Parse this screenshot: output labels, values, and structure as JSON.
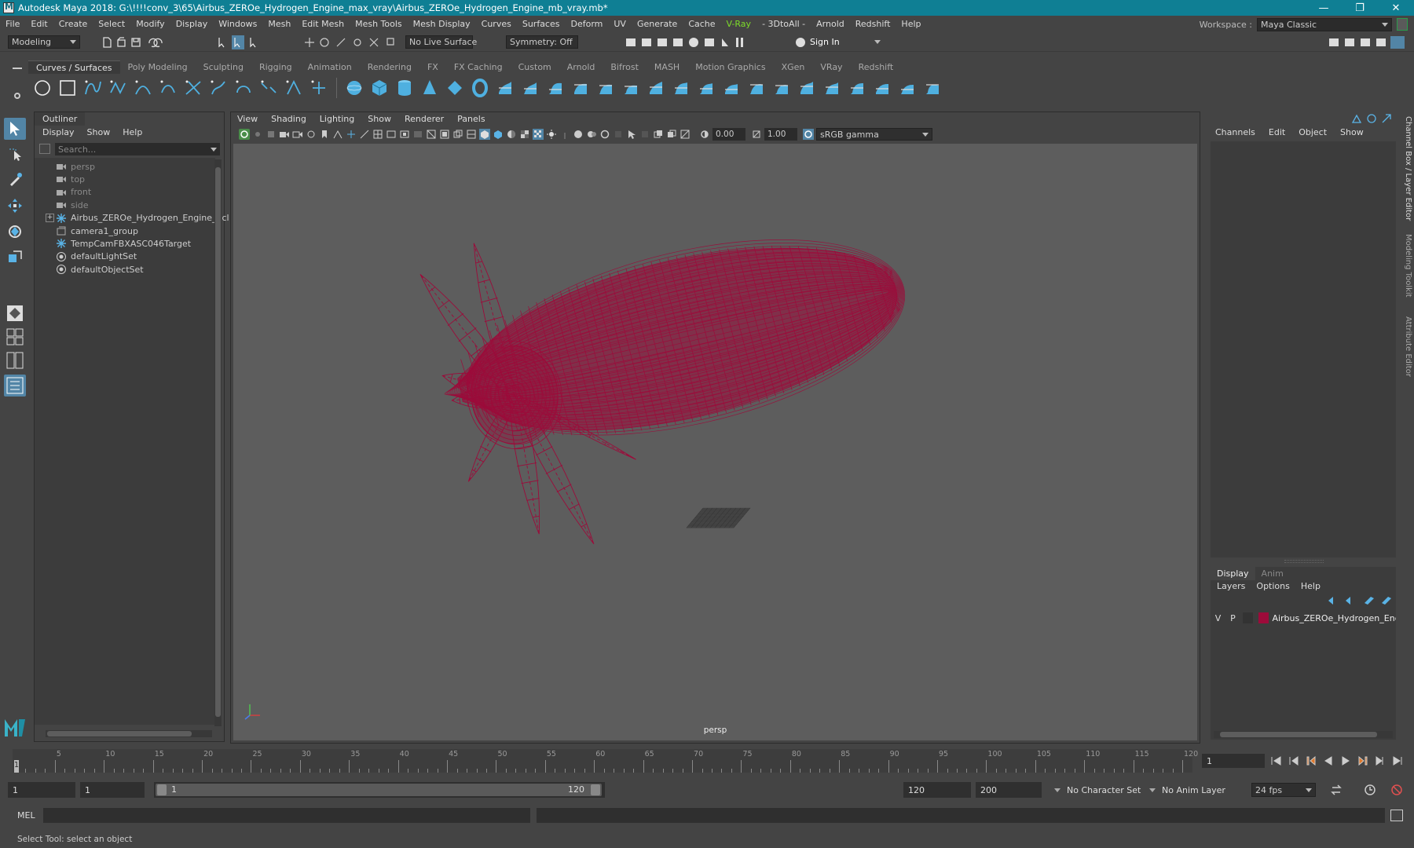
{
  "app": {
    "title": "Autodesk Maya 2018: G:\\!!!!conv_3\\65\\Airbus_ZEROe_Hydrogen_Engine_max_vray\\Airbus_ZEROe_Hydrogen_Engine_mb_vray.mb*",
    "window_buttons": [
      "—",
      "❐",
      "✕"
    ]
  },
  "menubar": {
    "items": [
      "File",
      "Edit",
      "Create",
      "Select",
      "Modify",
      "Display",
      "Windows",
      "Mesh",
      "Edit Mesh",
      "Mesh Tools",
      "Mesh Display",
      "Curves",
      "Surfaces",
      "Deform",
      "UV",
      "Generate",
      "Cache",
      "V-Ray",
      "- 3DtoAll -",
      "Arnold",
      "Redshift",
      "Help"
    ],
    "workspace_label": "Workspace :",
    "workspace_value": "Maya Classic"
  },
  "statusline": {
    "menuset": "Modeling",
    "live_surface": "No Live Surface",
    "symmetry": "Symmetry: Off",
    "sign_in": "Sign In"
  },
  "shelf": {
    "tabs": [
      "Curves / Surfaces",
      "Poly Modeling",
      "Sculpting",
      "Rigging",
      "Animation",
      "Rendering",
      "FX",
      "FX Caching",
      "Custom",
      "Arnold",
      "Bifrost",
      "MASH",
      "Motion Graphics",
      "XGen",
      "VRay",
      "Redshift"
    ],
    "active_tab": "Curves / Surfaces",
    "icons": [
      "nurbs-circle-icon",
      "nurbs-square-icon",
      "ep-curve-icon",
      "pencil-curve-icon",
      "bezier-curve-icon",
      "cv-curve-icon",
      "curve-tool-icon",
      "arc-icon",
      "attach-curve-icon",
      "detach-curve-icon",
      "rebuild-curve-icon",
      "insert-knot-icon",
      "sphere-icon",
      "cube-icon",
      "cylinder-icon",
      "cone-icon",
      "plane-icon",
      "torus-icon",
      "revolve-icon",
      "loft-icon",
      "planar-icon",
      "extrude-icon",
      "birail-icon",
      "bevel-icon",
      "surface-fillet-icon",
      "boundary-icon",
      "square-surface-icon",
      "trim-icon",
      "untrim-icon",
      "intersect-icon",
      "project-curve-icon",
      "stitch-icon",
      "sculpt-icon",
      "nurbs-to-poly-icon",
      "rebuild-surface-icon",
      "smooth-icon"
    ]
  },
  "outliner": {
    "tab": "Outliner",
    "menu": [
      "Display",
      "Show",
      "Help"
    ],
    "search_placeholder": "Search...",
    "items": [
      {
        "label": "persp",
        "type": "camera",
        "dim": true
      },
      {
        "label": "top",
        "type": "camera",
        "dim": true
      },
      {
        "label": "front",
        "type": "camera",
        "dim": true
      },
      {
        "label": "side",
        "type": "camera",
        "dim": true
      },
      {
        "label": "Airbus_ZEROe_Hydrogen_Engine_ncl",
        "type": "transform",
        "dim": false,
        "expandable": true
      },
      {
        "label": "camera1_group",
        "type": "group",
        "dim": false
      },
      {
        "label": "TempCamFBXASC046Target",
        "type": "transform",
        "dim": false
      },
      {
        "label": "defaultLightSet",
        "type": "set",
        "dim": false
      },
      {
        "label": "defaultObjectSet",
        "type": "set",
        "dim": false
      }
    ]
  },
  "viewport": {
    "menu": [
      "View",
      "Shading",
      "Lighting",
      "Show",
      "Renderer",
      "Panels"
    ],
    "exposure": "0.00",
    "gamma": "1.00",
    "color_space": "sRGB gamma",
    "camera": "persp",
    "wire_color": "#9c0b3a"
  },
  "channelbox": {
    "menu": [
      "Channels",
      "Edit",
      "Object",
      "Show"
    ],
    "side_tabs": [
      "Channel Box / Layer Editor",
      "Modeling Toolkit",
      "Attribute Editor"
    ]
  },
  "layereditor": {
    "tabs": [
      "Display",
      "Anim"
    ],
    "active_tab": "Display",
    "menu": [
      "Layers",
      "Options",
      "Help"
    ],
    "layers": [
      {
        "v": "V",
        "p": "P",
        "name": "Airbus_ZEROe_Hydrogen_Engi",
        "color": "#9c0b3a"
      }
    ]
  },
  "timeline": {
    "start": 1,
    "end": 120,
    "step": 5,
    "current_frame_field": "1",
    "playback_buttons": [
      "go-to-start-icon",
      "step-back-key-icon",
      "step-back-frame-icon",
      "play-backward-icon",
      "play-forward-icon",
      "step-forward-frame-icon",
      "step-forward-key-icon",
      "go-to-end-icon"
    ]
  },
  "range": {
    "anim_start": "1",
    "playback_start": "1",
    "slider_start": "1",
    "slider_end": "120",
    "playback_end": "120",
    "anim_end": "200",
    "character_set": "No Character Set",
    "anim_layer": "No Anim Layer",
    "fps": "24 fps"
  },
  "command": {
    "language": "MEL"
  },
  "help": {
    "text": "Select Tool: select an object"
  }
}
